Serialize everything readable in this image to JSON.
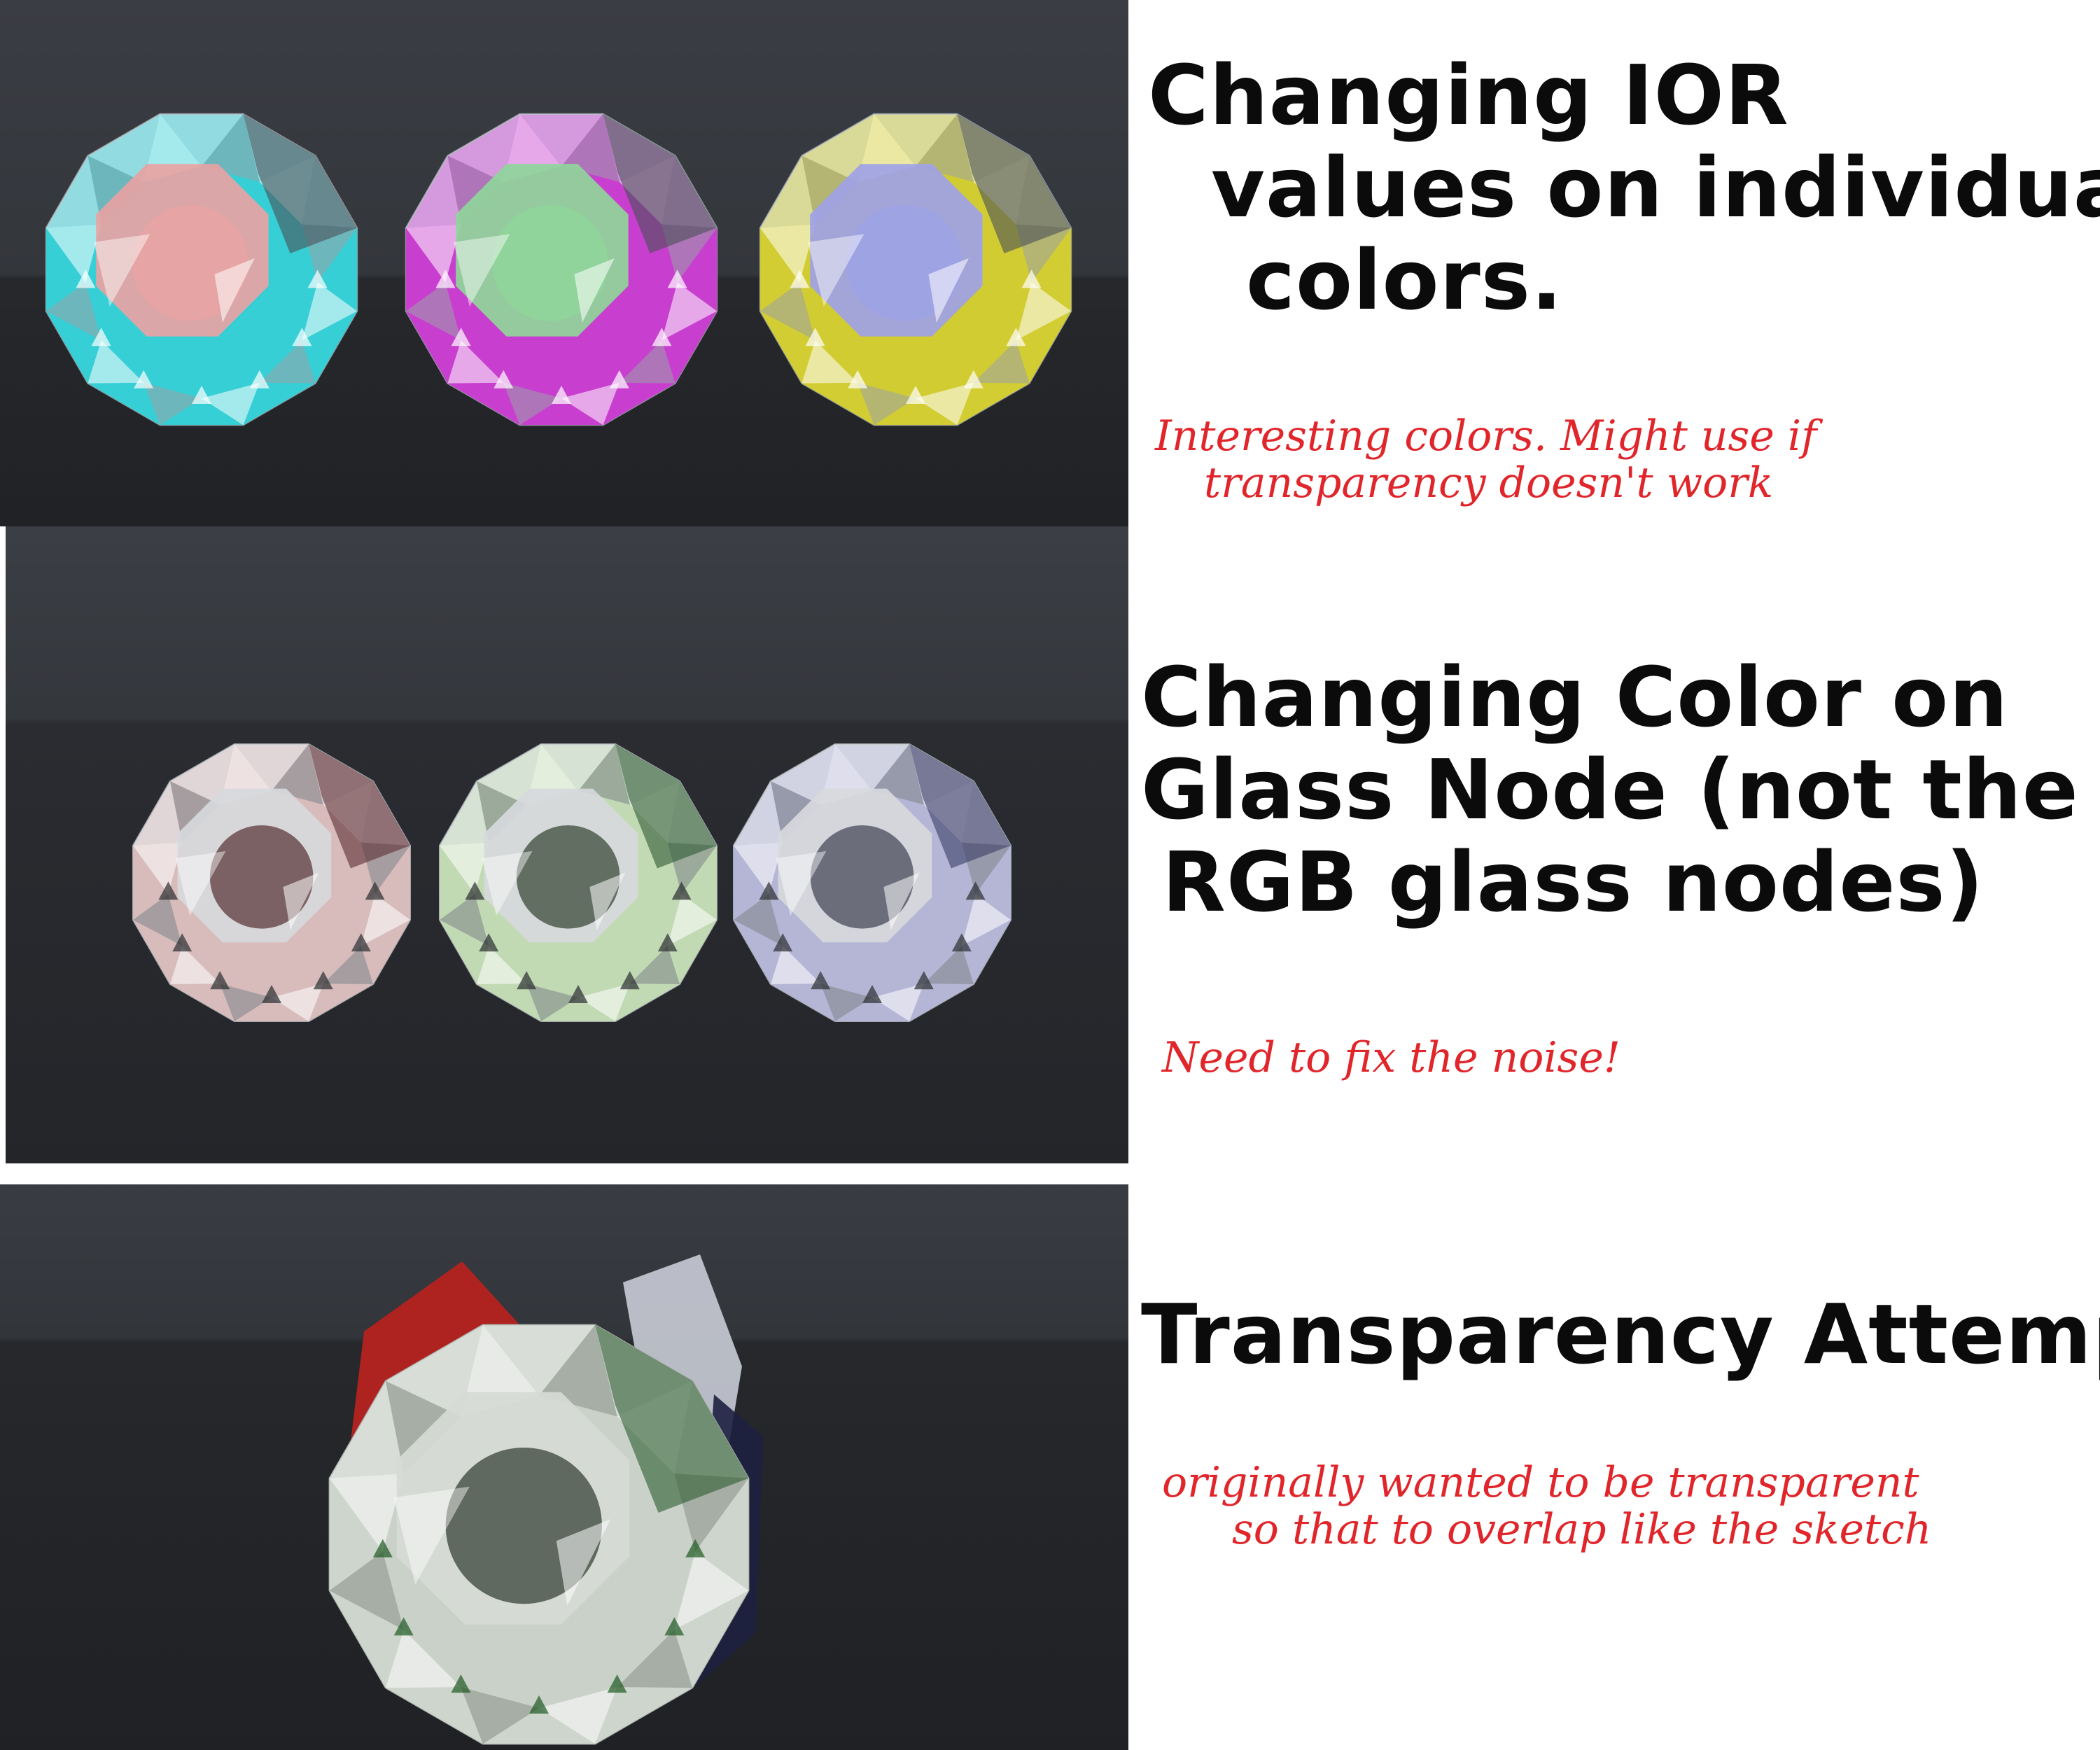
{
  "notes": [
    {
      "heading": [
        "Changing IOR",
        "values on individual",
        "colors."
      ],
      "comment": [
        "Interesting colors. Might use if",
        "transparency doesn't work"
      ]
    },
    {
      "heading": [
        "Changing Color on",
        "Glass Node (not the",
        "RGB glass nodes)"
      ],
      "comment": [
        "Need to fix the noise!"
      ]
    },
    {
      "heading": [
        "Transparency Attempt"
      ],
      "comment": [
        "originally wanted to be transparent",
        "so that to overlap like the sketch"
      ]
    }
  ],
  "colors": {
    "background_dark": "#2a2c30",
    "heading_ink": "#0b0b0b",
    "comment_ink": "#e0262b",
    "gem_row1_accents": [
      "#37cfd6",
      "#c83fcf",
      "#d2cc33"
    ],
    "gem_row1_tops": [
      "#e8a3a3",
      "#8fd69a",
      "#9ea2e6"
    ],
    "gem_row2_tints": [
      "#d8bcbc",
      "#c2dab4",
      "#b5b6d6"
    ]
  },
  "renders": [
    {
      "name": "ior-gems",
      "gem_count": 3
    },
    {
      "name": "glass-node-color-gems",
      "gem_count": 3
    },
    {
      "name": "transparency-gem",
      "gem_count": 1
    }
  ]
}
